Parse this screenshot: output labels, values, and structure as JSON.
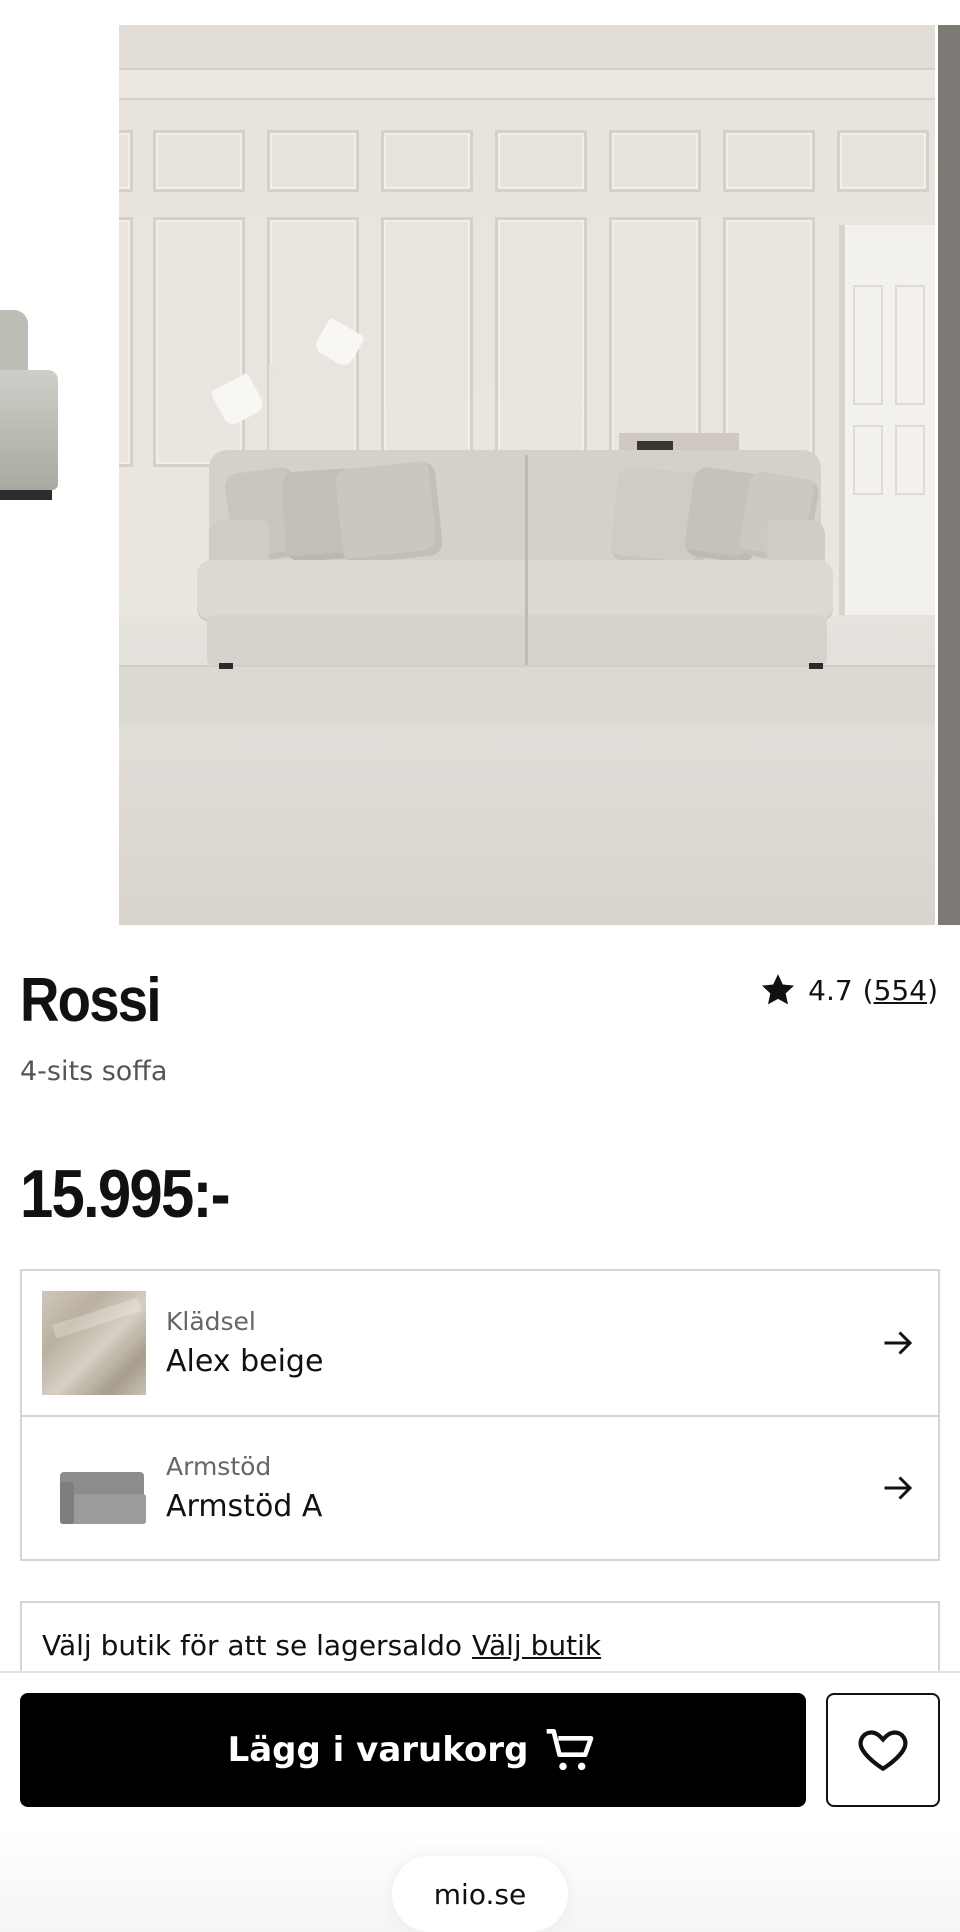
{
  "product": {
    "name": "Rossi",
    "subtitle": "4-sits soffa",
    "price": "15.995:-",
    "rating": "4.7",
    "rating_open": "(",
    "rating_count": "554",
    "rating_close": ")"
  },
  "options": [
    {
      "label": "Klädsel",
      "value": "Alex beige"
    },
    {
      "label": "Armstöd",
      "value": "Armstöd A"
    }
  ],
  "store": {
    "text": "Välj butik för att se lagersaldo",
    "link": "Välj butik"
  },
  "actions": {
    "add_to_cart": "Lägg i varukorg"
  },
  "browser": {
    "url": "mio.se"
  },
  "icons": [
    "star-icon",
    "arrow-right-icon",
    "cart-icon",
    "heart-icon"
  ],
  "colors": {
    "primary_button": "#000000",
    "border": "#d6d6d6"
  }
}
